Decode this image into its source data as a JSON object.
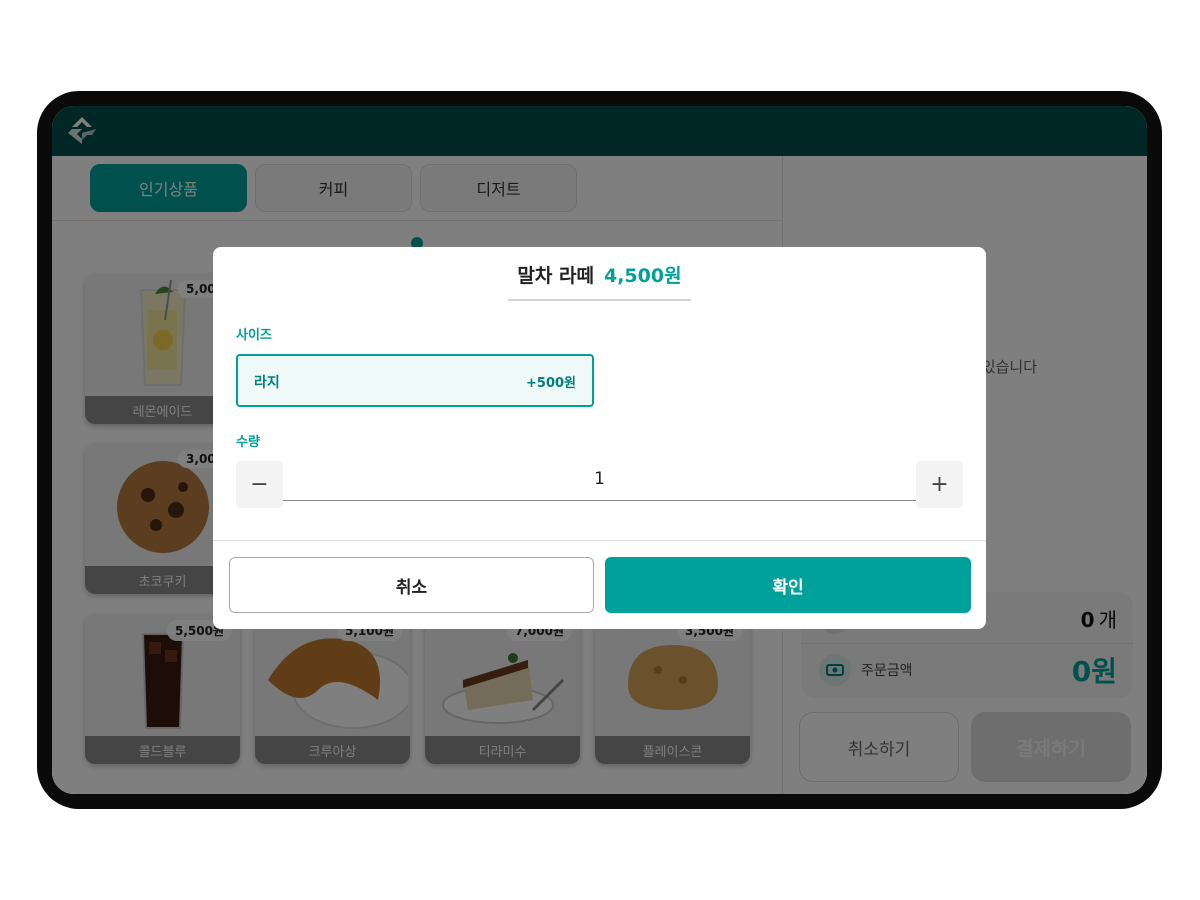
{
  "header": {
    "logo_icon": "kiosk-logo-icon"
  },
  "tabs": [
    {
      "label": "인기상품",
      "active": true
    },
    {
      "label": "커피",
      "active": false
    },
    {
      "label": "디저트",
      "active": false
    }
  ],
  "products": [
    {
      "name": "레몬에이드",
      "price": "5,000",
      "icon": "lemonade-image"
    },
    {
      "name": "초코쿠키",
      "price": "3,000",
      "icon": "cookie-image"
    },
    {
      "name": "콜드블루",
      "price": "5,500원",
      "icon": "cold-brew-image"
    },
    {
      "name": "크루아상",
      "price": "5,100원",
      "icon": "croissant-image"
    },
    {
      "name": "티라미수",
      "price": "7,000원",
      "icon": "tiramisu-image"
    },
    {
      "name": "플레이스콘",
      "price": "3,500원",
      "icon": "scone-image"
    }
  ],
  "cart": {
    "empty_text": "있습니다",
    "count_value": "0",
    "count_unit": "개",
    "total_label": "주문금액",
    "total_value": "0원",
    "cancel_label": "취소하기",
    "pay_label": "결제하기"
  },
  "modal": {
    "product_name": "말차 라떼",
    "product_price": "4,500원",
    "size_label": "사이즈",
    "size_option": {
      "name": "라지",
      "extra": "+500원",
      "selected": true
    },
    "quantity_label": "수량",
    "quantity_value": "1",
    "minus_symbol": "−",
    "plus_symbol": "+",
    "cancel_label": "취소",
    "confirm_label": "확인"
  },
  "colors": {
    "accent": "#00a09b",
    "header": "#004d4a",
    "overlay": "rgba(0,0,0,0.5)"
  }
}
